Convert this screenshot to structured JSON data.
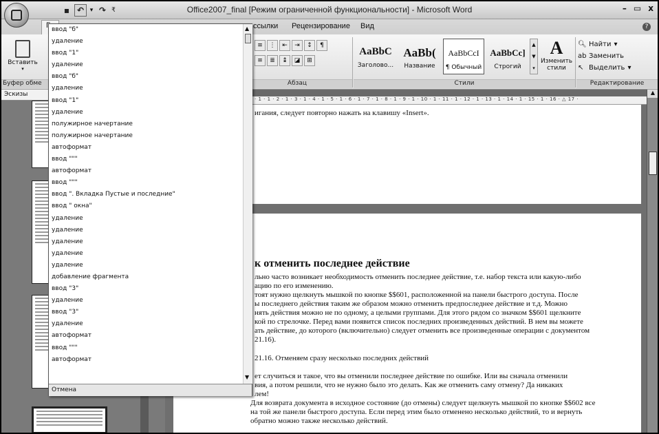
{
  "window": {
    "title": "Office2007_final [Режим ограниченной функциональности] - Microsoft Word",
    "minimize": "–",
    "maximize": "▭",
    "close": "x"
  },
  "qat": {
    "save": "▪",
    "undo": "↶",
    "undo_dropdown": "▾",
    "redo": "↷",
    "customize": "₹"
  },
  "tabs": {
    "home": "Гл",
    "references": "ссылки",
    "review": "Рецензирование",
    "view": "Вид",
    "help": "?"
  },
  "ribbon": {
    "paste_label": "Вставить",
    "clipboard_label": "Буфер обме",
    "paragraph_label": "Абзац",
    "styles_label": "Стили",
    "editing_label": "Редактирование",
    "styles": [
      {
        "sample": "AaBbC",
        "name": "Заголово..."
      },
      {
        "sample": "AaBb(",
        "name": "Название"
      },
      {
        "sample": "AaBbCcI",
        "name": "¶ Обычный"
      },
      {
        "sample": "AaBbCc]",
        "name": "Строгий"
      }
    ],
    "change_styles": "Изменить стили",
    "find": "Найти",
    "replace": "Заменить",
    "select": "Выделить"
  },
  "thumbs": {
    "header": "Эскизы"
  },
  "ruler": "· 1 · 1 · 2 · 1 · 3 · 1 · 4 · 1 · 5 · 1 · 6 · 1 · 7 · 1 · 8 · 1 · 9 · 1 · 10 · 1 · 11 · 1 · 12 · 1 · 13 · 1 · 14 · 1 · 15 · 1 · 16 · △ 17 ·",
  "document": {
    "page1_line": "игания, следует повторно нажать на клавишу «Insert».",
    "heading": "к отменить последнее действие",
    "para1": [
      "льно часто возникает необходимость отменить последнее действие, т.е. набор текста или какую-либо",
      "ацию по его изменению.",
      "тоят нужно щелкнуть мышкой по кнопке $$601, расположенной на панели быстрого доступа. После",
      "ы последнего действия таким же образом можно отменить предпоследнее действие и т.д. Можно",
      "нять действия можно не по одному, а целыми группами. Для этого рядом со значком $$601 щелкните",
      "кой по стрелочке. Перед вами появится список последних произведенных действий. В нем вы можете",
      "ать действие, до которого (включительно) следует отменить все произведенные операции с документом",
      "21.16)."
    ],
    "caption": "21.16. Отменяем сразу несколько последних действий",
    "para2": [
      "ет случиться и такое, что вы отменили последнее действие по ошибке. Или вы сначала отменили",
      "вия, а потом решили, что не нужно было это делать. Как же отменить саму отмену? Да никаких",
      "лем!"
    ],
    "para3": [
      "Для возврата документа в исходное состояние (до отмены) следует щелкнуть мышкой по кнопке $$602 все",
      "на той же панели быстрого доступа. Если перед этим было отменено несколько действий, то и вернуть",
      "обратно можно также несколько действий."
    ]
  },
  "undo_list": {
    "items": [
      "ввод \"б\"",
      "удаление",
      "ввод \"1\"",
      "удаление",
      "ввод \"б\"",
      "удаление",
      "ввод \"1\"",
      "удаление",
      "полужирное начертание",
      "полужирное начертание",
      "автоформат",
      "ввод \"\"\"",
      "автоформат",
      "ввод \"\"\"",
      "ввод \". Вкладка Пустые и последние\"",
      "ввод \" окна\"",
      "удаление",
      "удаление",
      "удаление",
      "удаление",
      "удаление",
      "добавление фрагмента",
      "ввод \"3\"",
      "удаление",
      "ввод \"3\"",
      "удаление",
      "автоформат",
      "ввод \"\"\"",
      "автоформат"
    ],
    "footer": "Отмена"
  }
}
